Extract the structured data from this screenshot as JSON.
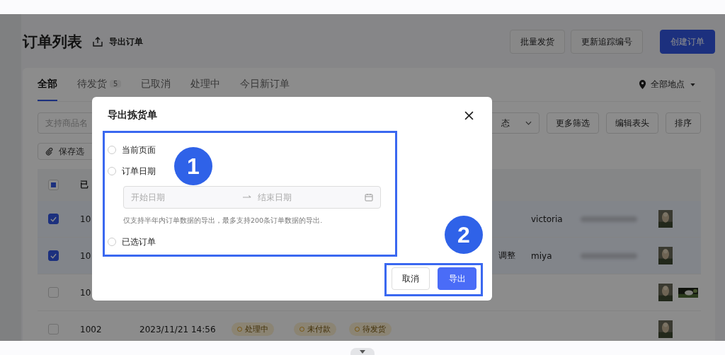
{
  "header": {
    "title": "订单列表",
    "export_link": "导出订单",
    "buttons": [
      {
        "label": "批量发货",
        "kind": "default"
      },
      {
        "label": "更新追踪编号",
        "kind": "default"
      },
      {
        "label": "创建订单",
        "kind": "primary"
      }
    ]
  },
  "tabs": [
    {
      "label": "全部",
      "selected": true
    },
    {
      "label": "待发货",
      "badge": "5",
      "selected": false
    },
    {
      "label": "已取消",
      "selected": false
    },
    {
      "label": "处理中",
      "selected": false
    },
    {
      "label": "今日新订单",
      "selected": false
    }
  ],
  "location": "全部地点",
  "filters": {
    "search_placeholder": "支持商品名",
    "status_select": "态",
    "buttons": [
      "更多筛选",
      "编辑表头",
      "排序"
    ],
    "save_button": "保存选"
  },
  "table": {
    "header": {
      "indeterminate": true,
      "column_2": "已"
    },
    "rows": [
      {
        "checked": true,
        "column_2": "10",
        "name": "victoria",
        "thumbs": [
          {
            "kind": "picture"
          }
        ]
      },
      {
        "checked": true,
        "column_2": "10",
        "column_7": "调整",
        "name": "miya",
        "thumbs": [
          {
            "kind": "picture"
          }
        ]
      },
      {
        "checked": false,
        "column_2": "10",
        "thumbs": [
          {
            "kind": "picture"
          },
          {
            "kind": "picture"
          }
        ]
      },
      {
        "checked": false,
        "column_2": "1002",
        "date": "2023/11/21 14:56",
        "tags": [
          "处理中",
          "未付款",
          "待发货"
        ],
        "thumbs": [
          {
            "kind": "picture"
          }
        ]
      }
    ]
  },
  "dialog": {
    "title": "导出拣货单",
    "options": [
      {
        "label": "当前页面",
        "selected": false
      },
      {
        "label": "订单日期",
        "selected": false
      },
      {
        "label": "已选订单",
        "selected": false
      }
    ],
    "date_range": {
      "start_placeholder": "开始日期",
      "end_placeholder": "结束日期"
    },
    "hint": "仅支持半年内订单数据的导出，最多支持200条订单数据的导出.",
    "buttons": [
      {
        "label": "取消",
        "kind": "default"
      },
      {
        "label": "导出",
        "kind": "primary"
      }
    ]
  },
  "annotations": [
    "1",
    "2"
  ]
}
